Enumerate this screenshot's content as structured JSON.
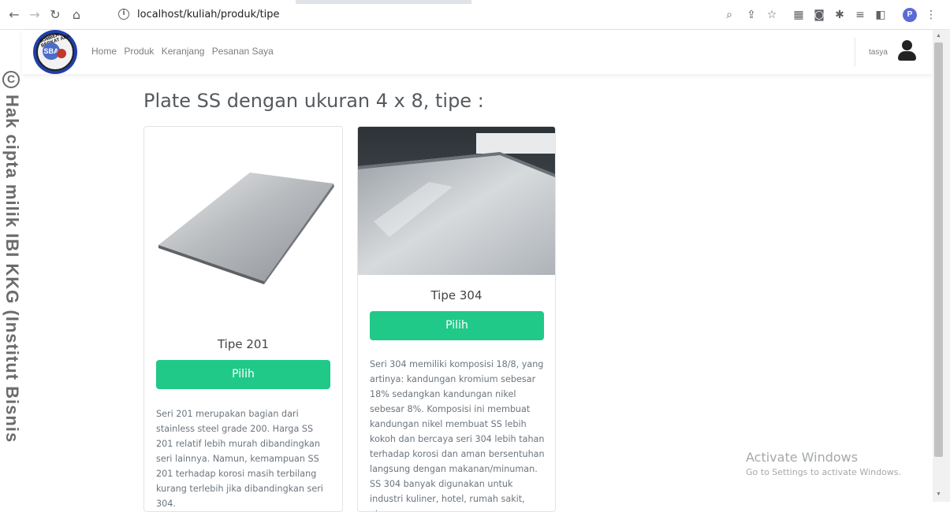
{
  "browser": {
    "url": "localhost/kuliah/produk/tipe",
    "profile_letter": "P"
  },
  "watermark": {
    "copyright_symbol": "C",
    "text": "Hak cipta milik IBI KKG (Institut Bisnis"
  },
  "navbar": {
    "logo_text": "SUMBER BERKAT ABADI",
    "logo_center": "SBA",
    "links": [
      "Home",
      "Produk",
      "Keranjang",
      "Pesanan Saya"
    ],
    "username": "tasya"
  },
  "main": {
    "heading": "Plate SS dengan ukuran 4 x 8, tipe :",
    "cards": [
      {
        "title": "Tipe 201",
        "button": "Pilih",
        "description": "Seri 201 merupakan bagian dari stainless steel grade 200. Harga SS 201 relatif lebih murah dibandingkan seri lainnya. Namun, kemampuan SS 201 terhadap korosi masih terbilang kurang terlebih jika dibandingkan seri 304."
      },
      {
        "title": "Tipe 304",
        "button": "Pilih",
        "description": "Seri 304 memiliki komposisi 18/8, yang artinya: kandungan kromium sebesar 18% sedangkan kandungan nikel sebesar 8%. Komposisi ini membuat kandungan nikel membuat SS lebih kokoh dan bercaya seri 304 lebih tahan terhadap korosi dan aman bersentuhan langsung dengan makanan/minuman. SS 304 banyak digunakan untuk industri kuliner, hotel, rumah sakit, atau"
      }
    ]
  },
  "os_overlay": {
    "title": "Activate Windows",
    "subtitle": "Go to Settings to activate Windows."
  },
  "colors": {
    "accent": "#20c987",
    "heading": "#555a5f",
    "text_muted": "#6c757d"
  }
}
